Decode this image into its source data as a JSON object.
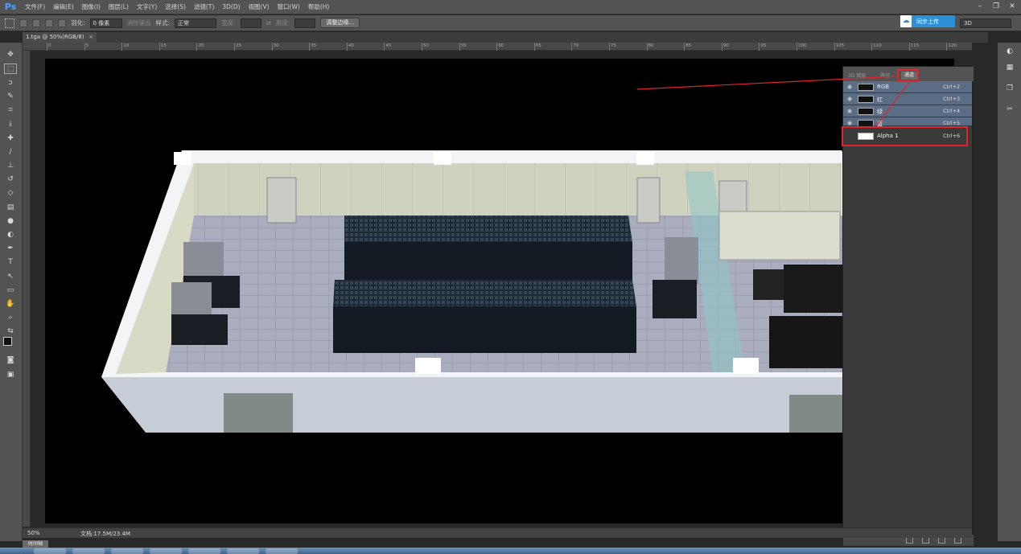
{
  "app": {
    "logo": "Ps"
  },
  "menu": [
    "文件(F)",
    "编辑(E)",
    "图像(I)",
    "图层(L)",
    "文字(Y)",
    "选择(S)",
    "滤镜(T)",
    "3D(D)",
    "视图(V)",
    "窗口(W)",
    "帮助(H)"
  ],
  "options": {
    "feather_label": "羽化:",
    "feather_value": "0 像素",
    "antialias_label": "消除锯齿",
    "style_label": "样式:",
    "style_value": "正常",
    "width_label": "宽度:",
    "height_label": "高度:",
    "refine_edge_button": "调整边缘..."
  },
  "cloud": {
    "label": "同步上传"
  },
  "workspace": {
    "value": "3D"
  },
  "tab": {
    "title": "1.tga @ 50%(RGB/8)",
    "close": "×"
  },
  "ruler_ticks": [
    "0",
    "5",
    "10",
    "15",
    "20",
    "25",
    "30",
    "35",
    "40",
    "45",
    "50",
    "55",
    "60",
    "65",
    "70",
    "75",
    "80",
    "85",
    "90",
    "95",
    "100",
    "105",
    "110",
    "115",
    "120"
  ],
  "panel": {
    "tabs": [
      "3D 图层",
      "路径",
      "通道"
    ],
    "channels": [
      {
        "name": "RGB",
        "shortcut": "Ctrl+2"
      },
      {
        "name": "红",
        "shortcut": "Ctrl+3"
      },
      {
        "name": "绿",
        "shortcut": "Ctrl+4"
      },
      {
        "name": "蓝",
        "shortcut": "Ctrl+5"
      },
      {
        "name": "Alpha 1",
        "shortcut": "Ctrl+6"
      }
    ]
  },
  "status": {
    "zoom": "50%",
    "doc": "文档:17.5M/23.4M"
  },
  "timeline": {
    "label": "时间轴"
  },
  "colors": {
    "accent": "#2d8fd6",
    "annotation": "#e0242c",
    "selected_row": "#5b6d84"
  }
}
